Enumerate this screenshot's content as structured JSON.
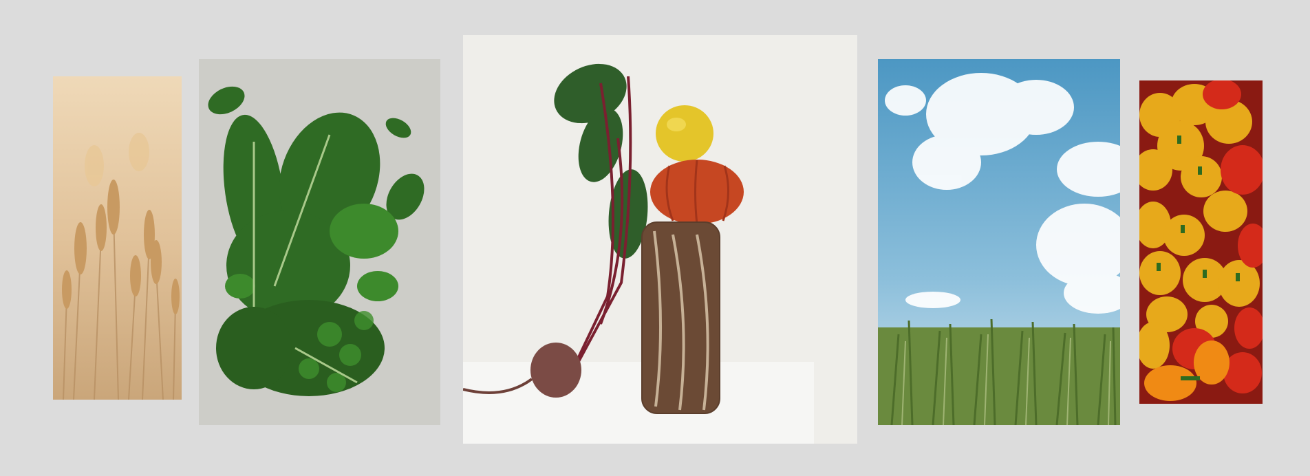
{
  "gallery": {
    "background": "#dcdcdc",
    "items": [
      {
        "id": "wheat",
        "subject": "wheat-ears"
      },
      {
        "id": "greens",
        "subject": "leafy-greens-and-kale"
      },
      {
        "id": "still-life",
        "subject": "beet-lemon-tomato-bread-stack"
      },
      {
        "id": "field",
        "subject": "corn-field-under-cloudy-sky"
      },
      {
        "id": "peppers",
        "subject": "yellow-and-red-bell-peppers"
      }
    ]
  }
}
